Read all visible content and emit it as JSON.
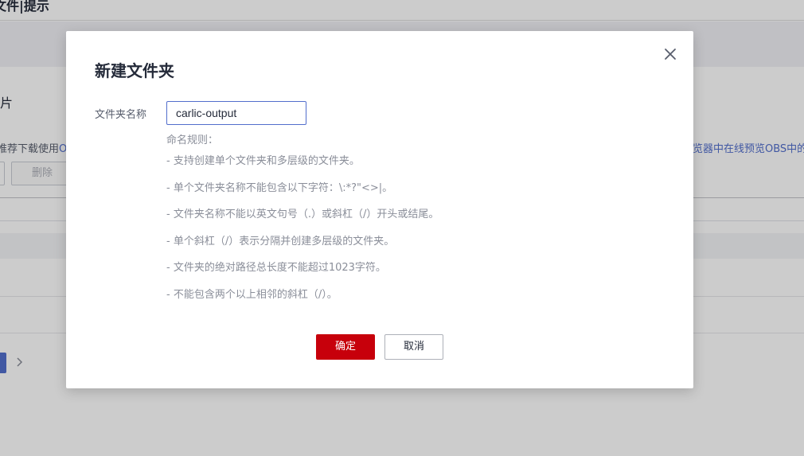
{
  "background": {
    "title_fragment": "文件|提示",
    "section_title_fragment": "片",
    "tip_left_fragment": "推荐下载使用",
    "tip_left_link_fragment": "O",
    "tip_right_fragment": "览器中在线预览OBS中的",
    "delete_button": "删除"
  },
  "dialog": {
    "title": "新建文件夹",
    "field_label": "文件夹名称",
    "folder_name_value": "carlic-output",
    "rules_heading": "命名规则：",
    "rules": [
      "- 支持创建单个文件夹和多层级的文件夹。",
      "- 单个文件夹名称不能包含以下字符：\\:*?\"<>|。",
      "- 文件夹名称不能以英文句号（.）或斜杠（/）开头或结尾。",
      "- 单个斜杠（/）表示分隔并创建多层级的文件夹。",
      "- 文件夹的绝对路径总长度不能超过1023字符。",
      "- 不能包含两个以上相邻的斜杠（/）。"
    ],
    "confirm_button": "确定",
    "cancel_button": "取消"
  },
  "icons": {
    "close": "close-icon",
    "next_page": "chevron-right-icon"
  },
  "colors": {
    "primary_red": "#c7000b",
    "link_blue": "#526ecc",
    "input_border": "#526ecc"
  }
}
